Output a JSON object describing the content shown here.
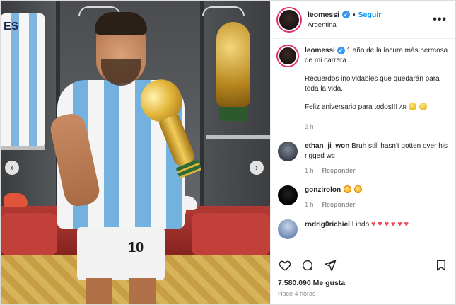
{
  "post": {
    "photo_alt": "",
    "jersey_back_text": "ES",
    "shorts_number": "10"
  },
  "header": {
    "username": "leomessi",
    "verified_badge": "✓",
    "dot": "•",
    "follow_label": "Seguir",
    "location": "Argentina",
    "more_label": "•••"
  },
  "caption": {
    "username": "leomessi",
    "text_line1": "1 año de la locura más hermosa de mi carrera...",
    "text_line2": "Recuerdos inolvidables que quedarán para toda la vida.",
    "text_line3": "Feliz aniversario para todos!!!",
    "text_line3_flag": "AR",
    "time": "3 h"
  },
  "comments": [
    {
      "username": "ethan_ji_won",
      "text": "Bruh still hasn't gotten over his rigged wc",
      "time": "1 h",
      "reply_label": "Responder"
    },
    {
      "username": "gonzirolon",
      "text": "",
      "time": "1 h",
      "reply_label": "Responder"
    },
    {
      "username": "rodrig0richiel",
      "text": "Lindo",
      "time": "",
      "reply_label": ""
    }
  ],
  "footer": {
    "likes": "7.580.090 Me gusta",
    "time_ago": "Hace 4 horas"
  },
  "icons": {
    "heart": "heart-icon",
    "comment": "comment-icon",
    "share": "paper-plane-icon",
    "save": "bookmark-icon",
    "carousel_prev": "chevron-left-icon",
    "carousel_next": "chevron-right-icon"
  },
  "colors": {
    "accent": "#0095f6",
    "verified": "#3897f0",
    "heart": "#ed4956",
    "muted": "#8e8e8e"
  }
}
